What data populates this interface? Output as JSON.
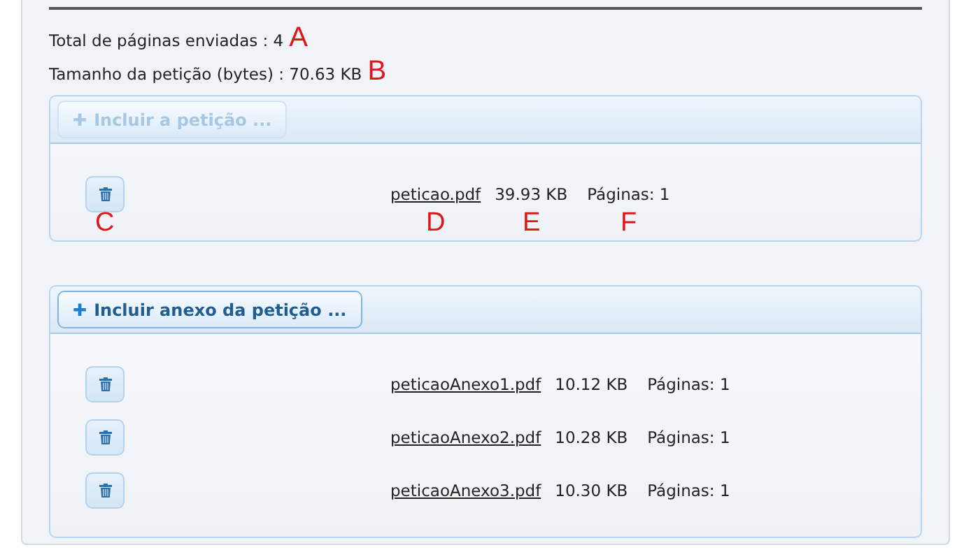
{
  "summary": [
    {
      "label": "Total de páginas enviadas : 4",
      "annotation": "A"
    },
    {
      "label": "Tamanho da petição (bytes) : 70.63 KB",
      "annotation": "B"
    }
  ],
  "sections": [
    {
      "button": {
        "icon": "✚",
        "label": "Incluir a petição ...",
        "disabled": true
      },
      "files": [
        {
          "name": "peticao.pdf",
          "size": "39.93 KB",
          "pages": "Páginas: 1",
          "annotations": {
            "delete": "C",
            "name": "D",
            "size": "E",
            "pages": "F"
          }
        }
      ]
    },
    {
      "button": {
        "icon": "✚",
        "label": "Incluir anexo da petição ...",
        "disabled": false
      },
      "files": [
        {
          "name": "peticaoAnexo1.pdf",
          "size": "10.12 KB",
          "pages": "Páginas: 1"
        },
        {
          "name": "peticaoAnexo2.pdf",
          "size": "10.28 KB",
          "pages": "Páginas: 1"
        },
        {
          "name": "peticaoAnexo3.pdf",
          "size": "10.30 KB",
          "pages": "Páginas: 1"
        }
      ]
    }
  ]
}
